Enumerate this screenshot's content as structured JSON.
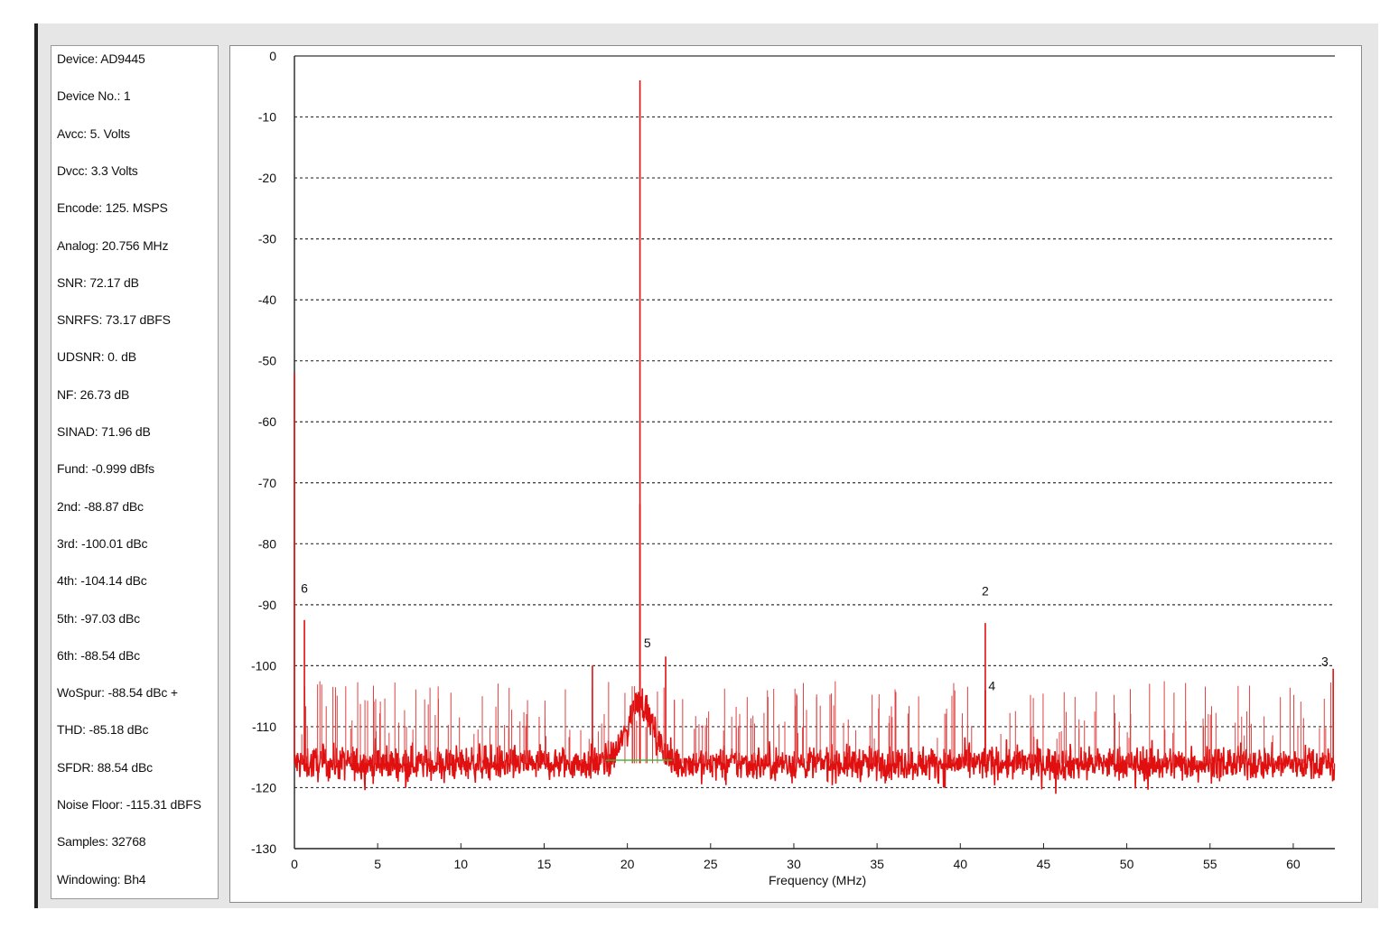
{
  "info_panel": {
    "lines": [
      "Device: AD9445",
      "Device No.: 1",
      "Avcc: 5. Volts",
      "Dvcc: 3.3 Volts",
      "Encode: 125. MSPS",
      "Analog: 20.756 MHz",
      "SNR: 72.17 dB",
      "SNRFS: 73.17 dBFS",
      "UDSNR: 0. dB",
      "NF: 26.73 dB",
      "SINAD: 71.96 dB",
      "Fund: -0.999 dBfs",
      "2nd: -88.87 dBc",
      "3rd: -100.01 dBc",
      "4th: -104.14 dBc",
      "5th: -97.03 dBc",
      "6th: -88.54 dBc",
      "WoSpur: -88.54 dBc +",
      "THD: -85.18 dBc",
      "SFDR: 88.54 dBc",
      "Noise Floor: -115.31 dBFS",
      "Samples: 32768",
      "Windowing: Bh4"
    ]
  },
  "chart_data": {
    "type": "line",
    "title": "",
    "xlabel": "Frequency (MHz)",
    "ylabel": "",
    "xlim": [
      0,
      62.5
    ],
    "ylim": [
      -130,
      0
    ],
    "x_ticks": [
      0,
      5,
      10,
      15,
      20,
      25,
      30,
      35,
      40,
      45,
      50,
      55,
      60
    ],
    "y_ticks": [
      0,
      -10,
      -20,
      -30,
      -40,
      -50,
      -60,
      -70,
      -80,
      -90,
      -100,
      -110,
      -120,
      -130
    ],
    "x_tick_labels": [
      "0",
      "5",
      "10",
      "15",
      "20",
      "25",
      "30",
      "35",
      "40",
      "45",
      "50",
      "55",
      "60"
    ],
    "y_tick_labels": [
      "0",
      "-10",
      "-20",
      "-30",
      "-40",
      "-50",
      "-60",
      "-70",
      "-80",
      "-90",
      "-100",
      "-110",
      "-120",
      "-130"
    ],
    "grid": "horizontal dotted",
    "line_color": "#e01010",
    "noise_floor_dB": -116,
    "noise_floor_marker": {
      "x_start": 18.7,
      "x_end": 22.7,
      "y": -115.5,
      "color": "#33bb33"
    },
    "signal_peaks": [
      {
        "x": 0.0,
        "y": -52
      },
      {
        "x": 0.6,
        "y": -92.5
      },
      {
        "x": 20.756,
        "y": -4
      },
      {
        "x": 20.756,
        "y": -73.5
      },
      {
        "x": 17.9,
        "y": -100
      },
      {
        "x": 22.3,
        "y": -98.5
      },
      {
        "x": 41.5,
        "y": -93
      },
      {
        "x": 41.5,
        "y": -104
      },
      {
        "x": 62.4,
        "y": -100.5
      }
    ],
    "harmonic_markers": [
      {
        "label": "6",
        "x": 0.6,
        "y": -88
      },
      {
        "label": "5",
        "x": 21.2,
        "y": -97
      },
      {
        "label": "2",
        "x": 41.5,
        "y": -88.5
      },
      {
        "label": "4",
        "x": 41.9,
        "y": -104
      },
      {
        "label": "3",
        "x": 61.9,
        "y": -100
      }
    ]
  }
}
